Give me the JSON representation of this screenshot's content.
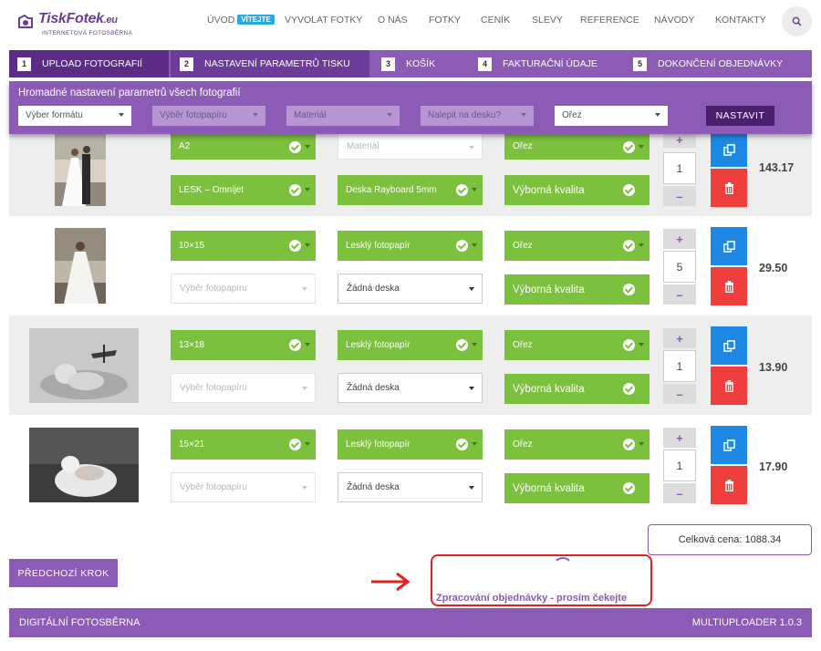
{
  "logo": {
    "name": "TiskFotek",
    "tld": ".eu",
    "subtitle": "INTERNETOVÁ FOTOSBĚRNA"
  },
  "nav": {
    "items": [
      "ÚVOD",
      "VYVOLAT FOTKY",
      "O NÁS",
      "FOTKY",
      "CENÍK",
      "SLEVY",
      "REFERENCE",
      "NÁVODY",
      "KONTAKTY"
    ],
    "badge": "VÍTEJTE"
  },
  "steps": [
    {
      "num": "1",
      "label": "UPLOAD FOTOGRAFIÍ"
    },
    {
      "num": "2",
      "label": "NASTAVENÍ PARAMETRŮ TISKU"
    },
    {
      "num": "3",
      "label": "KOŠÍK"
    },
    {
      "num": "4",
      "label": "FAKTURAČNÍ ÚDAJE"
    },
    {
      "num": "5",
      "label": "DOKONČENÍ OBJEDNÁVKY"
    }
  ],
  "bulk": {
    "title": "Hromadné nastavení parametrů všech fotografií",
    "selects": [
      "Výber formátu",
      "Výběr fotopapíru",
      "Materiál",
      "Nalepit na desku?",
      "Ořez"
    ],
    "apply_label": "NASTAVIT"
  },
  "rows": [
    {
      "format": "A2",
      "material": "Materiál",
      "crop": "Ořez",
      "paper": "LESK – Omnijet",
      "board": "Deska Rayboard 5mm",
      "quality": "Výborná kvalita",
      "qty": "1",
      "price": "143.17"
    },
    {
      "format": "10×15",
      "material": "Lesklý fotopapír",
      "crop": "Ořez",
      "paper": "Výběr fotopapíru",
      "board": "Žádná deska",
      "quality": "Výborná kvalita",
      "qty": "5",
      "price": "29.50"
    },
    {
      "format": "13×18",
      "material": "Lesklý fotopapír",
      "crop": "Ořez",
      "paper": "Výběr fotopapíru",
      "board": "Žádná deska",
      "quality": "Výborná kvalita",
      "qty": "1",
      "price": "13.90"
    },
    {
      "format": "15×21",
      "material": "Lesklý fotopapír",
      "crop": "Ořez",
      "paper": "Výběr fotopapíru",
      "board": "Žádná deska",
      "quality": "Výborná kvalita",
      "qty": "1",
      "price": "17.90"
    }
  ],
  "qty_controls": {
    "plus": "+",
    "minus": "–"
  },
  "total": "Celková cena: 1088.34",
  "prev_button": "PŘEDCHOZÍ KROK",
  "processing": "Zpracování objednávky - prosím čekejte",
  "footer": {
    "left": "DIGITÁLNÍ FOTOSBĚRNA",
    "right": "MULTIUPLOADER 1.0.3"
  },
  "colors": {
    "purple": "#8b5bb5",
    "dark_purple": "#5b2b86",
    "green": "#7cc13d",
    "blue": "#1e88e5",
    "red": "#ee3e3e",
    "highlight": "#e5201e"
  }
}
